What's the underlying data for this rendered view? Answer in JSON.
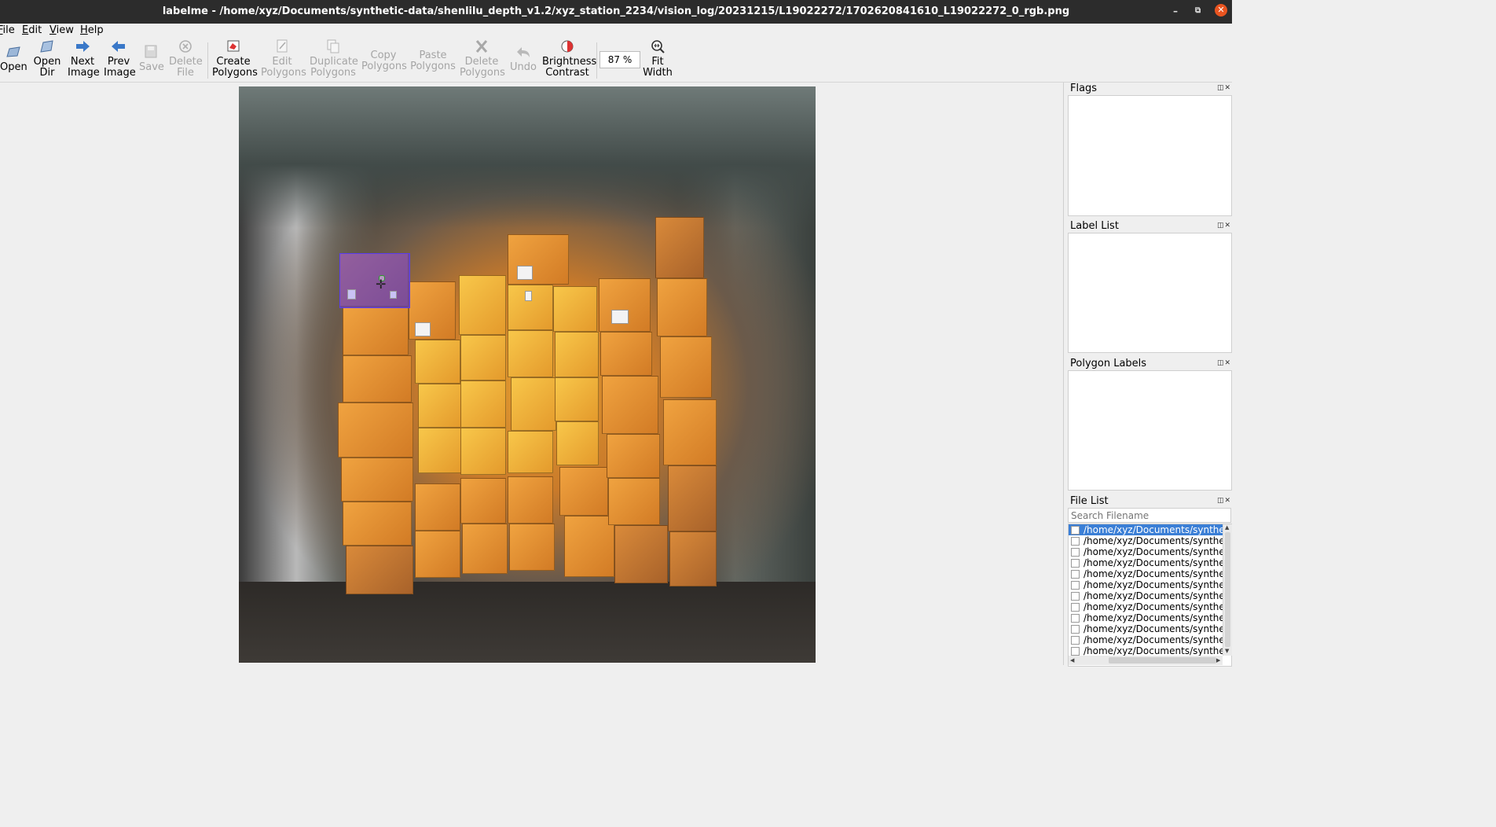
{
  "window": {
    "title": "labelme - /home/xyz/Documents/synthetic-data/shenlilu_depth_v1.2/xyz_station_2234/vision_log/20231215/L19022272/1702620841610_L19022272_0_rgb.png",
    "min_glyph": "–",
    "max_glyph": "⧉",
    "close_glyph": "✕"
  },
  "menu": {
    "file": {
      "u": "F",
      "rest": "ile"
    },
    "edit": {
      "u": "E",
      "rest": "dit"
    },
    "view": {
      "u": "V",
      "rest": "iew"
    },
    "help": {
      "u": "H",
      "rest": "elp"
    }
  },
  "toolbar": {
    "open": "Open",
    "open_dir": "Open\nDir",
    "next_image": "Next\nImage",
    "prev_image": "Prev\nImage",
    "save": "Save",
    "delete_file": "Delete\nFile",
    "create_polygons": "Create\nPolygons",
    "edit_polygons": "Edit\nPolygons",
    "duplicate_polygons": "Duplicate\nPolygons",
    "copy_polygons": "Copy\nPolygons",
    "paste_polygons": "Paste\nPolygons",
    "delete_polygons": "Delete\nPolygons",
    "undo": "Undo",
    "brightness_contrast": "Brightness\nContrast",
    "zoom_value": "87 %",
    "fit_width": "Fit\nWidth"
  },
  "docks": {
    "flags": "Flags",
    "label_list": "Label List",
    "polygon_labels": "Polygon Labels",
    "file_list": "File List",
    "dock_buttons": "◫✕"
  },
  "file_list": {
    "search_placeholder": "Search Filename",
    "items": [
      "/home/xyz/Documents/syntheti",
      "/home/xyz/Documents/syntheti",
      "/home/xyz/Documents/syntheti",
      "/home/xyz/Documents/syntheti",
      "/home/xyz/Documents/syntheti",
      "/home/xyz/Documents/syntheti",
      "/home/xyz/Documents/syntheti",
      "/home/xyz/Documents/syntheti",
      "/home/xyz/Documents/syntheti",
      "/home/xyz/Documents/syntheti",
      "/home/xyz/Documents/syntheti",
      "/home/xyz/Documents/syntheti"
    ]
  },
  "colors": {
    "selection": "#3b7fd6",
    "polygon_fill": "#5a3cf0",
    "close_button": "#e95420"
  }
}
